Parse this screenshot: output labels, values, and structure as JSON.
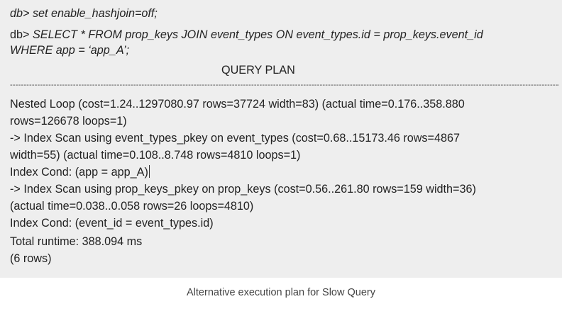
{
  "terminal": {
    "cmd1": "db> set enable_hashjoin=off;",
    "prompt": "db>",
    "query_line1": "SELECT * FROM prop_keys JOIN event_types ON event_types.id = prop_keys.event_id",
    "query_line2": "WHERE app = ‘app_A’;",
    "header": "QUERY PLAN",
    "divider": "----------------------------------------------------------------------------------------------------------------------------------------------------------------------------------------------------------------------------------",
    "plan_lines": [
      " Nested Loop  (cost=1.24..1297080.97 rows=37724 width=83) (actual time=0.176..358.880",
      "rows=126678 loops=1)",
      "   ->  Index Scan using event_types_pkey on event_types  (cost=0.68..15173.46 rows=4867",
      "width=55) (actual time=0.108..8.748 rows=4810 loops=1)",
      "         Index Cond: (app = app_A)",
      "   ->  Index Scan using prop_keys_pkey on prop_keys  (cost=0.56..261.80 rows=159 width=36)",
      "(actual time=0.038..0.058 rows=26 loops=4810)",
      "         Index Cond: (event_id = event_types.id)",
      " Total runtime: 388.094 ms",
      "(6 rows)"
    ]
  },
  "caption": "Alternative execution plan for Slow Query"
}
